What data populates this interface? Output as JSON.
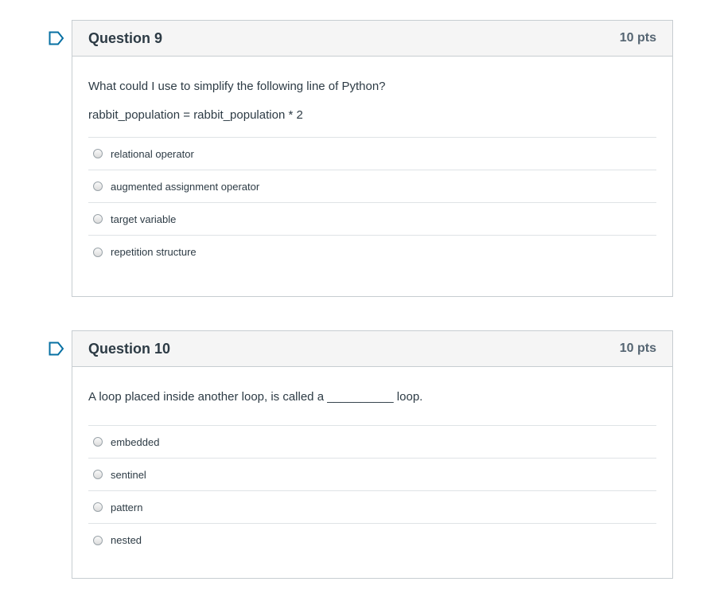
{
  "questions": [
    {
      "title": "Question 9",
      "points": "10 pts",
      "text": "What could I use to simplify the following line of Python?",
      "code": "rabbit_population = rabbit_population * 2",
      "answers": [
        "relational operator",
        "augmented assignment operator",
        "target variable",
        "repetition structure"
      ]
    },
    {
      "title": "Question 10",
      "points": "10 pts",
      "text": "A loop placed inside another loop, is called a __________ loop.",
      "answers": [
        "embedded",
        "sentinel",
        "pattern",
        "nested"
      ]
    }
  ],
  "icons": {
    "flag": "flag-question-icon",
    "flag_color": "#0770a3"
  }
}
